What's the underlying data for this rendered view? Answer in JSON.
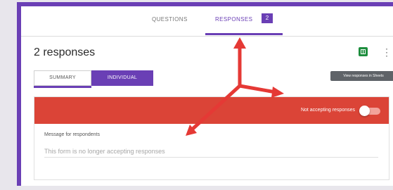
{
  "tabs": {
    "questions": "QUESTIONS",
    "responses": "RESPONSES",
    "responses_count": "2"
  },
  "summary": {
    "title": "2 responses",
    "tooltip": "View responses in Sheets",
    "view_summary": "SUMMARY",
    "view_individual": "INDIVIDUAL"
  },
  "banner": {
    "status_text": "Not accepting responses",
    "accepting_responses": false
  },
  "message": {
    "label": "Message for respondents",
    "value": "This form is no longer accepting responses"
  },
  "colors": {
    "accent": "#6a3fb5",
    "banner": "#db4437",
    "sheets": "#1e8e3e",
    "annotation": "#e53935"
  },
  "icons": {
    "sheets": "sheets-icon",
    "more": "more-vert-icon"
  }
}
